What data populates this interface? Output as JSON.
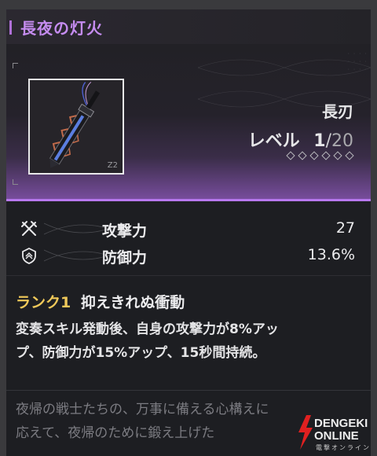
{
  "weapon": {
    "name": "長夜の灯火",
    "type": "長刃",
    "level_label": "レベル",
    "level": "1",
    "level_max": "20",
    "rank_stars": 6,
    "frame_number": "Z2"
  },
  "stats": [
    {
      "label": "攻撃力",
      "value": "27",
      "icon": "crossed-swords-icon"
    },
    {
      "label": "防御力",
      "value": "13.6%",
      "icon": "shield-icon"
    }
  ],
  "skill": {
    "rank_label": "ランク1",
    "name": "抑えきれぬ衝動",
    "description_line1": "変奏スキル発動後、自身の攻撃力が8%アッ",
    "description_line2": "プ、防御力が15%アップ、15秒間持続。"
  },
  "lore": {
    "line1": "夜帰の戦士たちの、万事に備える心構えに",
    "line2": "応えて、夜帰のために鍛え上げた"
  },
  "watermark": {
    "line1": "DENGEKI",
    "line2": "ONLINE",
    "line3": "電撃オンライン"
  },
  "colors": {
    "title": "#c58cf0",
    "accent_line": "#b778ee",
    "rank_tag": "#f0c95a"
  }
}
